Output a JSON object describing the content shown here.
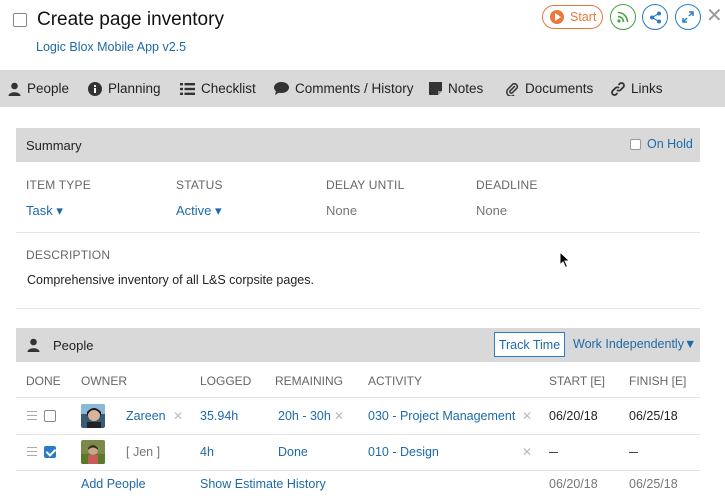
{
  "header": {
    "title": "Create page inventory",
    "subtitle": "Logic Blox Mobile App v2.5",
    "start_label": "Start"
  },
  "tabs": [
    {
      "label": "People",
      "icon": "person-icon"
    },
    {
      "label": "Planning",
      "icon": "info-icon"
    },
    {
      "label": "Checklist",
      "icon": "list-icon"
    },
    {
      "label": "Comments / History",
      "icon": "comment-icon"
    },
    {
      "label": "Notes",
      "icon": "note-icon"
    },
    {
      "label": "Documents",
      "icon": "paperclip-icon"
    },
    {
      "label": "Links",
      "icon": "link-icon"
    }
  ],
  "summary": {
    "title": "Summary",
    "on_hold_label": "On Hold",
    "fields": {
      "item_type": {
        "label": "ITEM TYPE",
        "value": "Task ▾"
      },
      "status": {
        "label": "STATUS",
        "value": "Active ▾"
      },
      "delay_until": {
        "label": "DELAY UNTIL",
        "value": "None"
      },
      "deadline": {
        "label": "DEADLINE",
        "value": "None"
      }
    },
    "description_label": "DESCRIPTION",
    "description": "Comprehensive inventory of all L&S corpsite pages."
  },
  "people": {
    "title": "People",
    "track_time_label": "Track Time",
    "work_independently_label": "Work Independently▼",
    "columns": [
      "DONE",
      "OWNER",
      "LOGGED",
      "REMAINING",
      "ACTIVITY",
      "START [E]",
      "FINISH [E]"
    ],
    "rows": [
      {
        "done": false,
        "owner": "Zareen",
        "logged": "35.94h",
        "remaining": "20h - 30h",
        "activity": "030 - Project Management",
        "start": "06/20/18",
        "finish": "06/25/18"
      },
      {
        "done": true,
        "owner": "[ Jen ]",
        "logged": "4h",
        "remaining": "Done",
        "activity": "010 - Design",
        "start": "",
        "finish": ""
      }
    ],
    "footer": {
      "add_people": "Add People",
      "show_estimate_history": "Show Estimate History",
      "start": "06/20/18",
      "finish": "06/25/18"
    }
  },
  "colors": {
    "accent_blue": "#1d6aa8",
    "start_orange": "#e8783c",
    "rss_green": "#47a33f",
    "bar_grey": "#d9d9d9"
  }
}
